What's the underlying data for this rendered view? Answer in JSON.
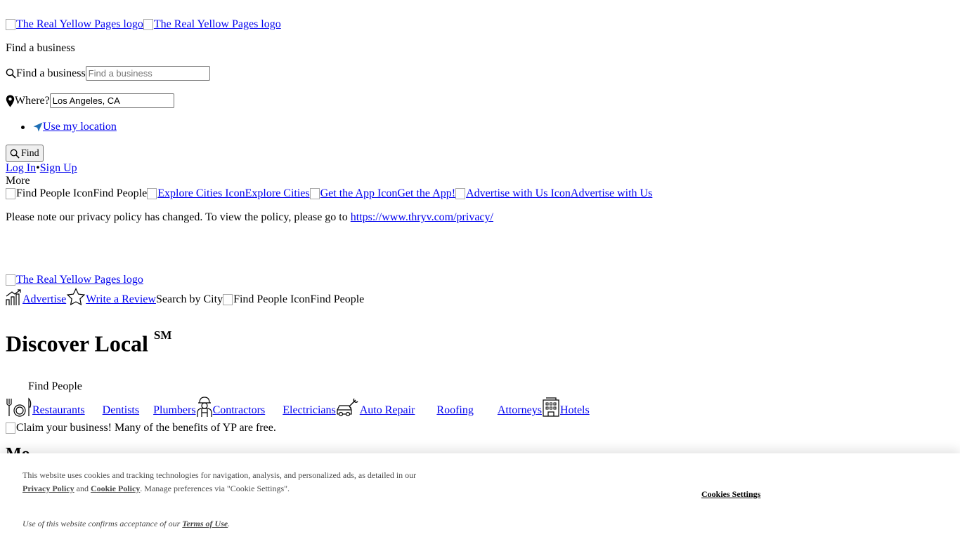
{
  "header": {
    "logo_alt_1": "The Real Yellow Pages logo",
    "logo_alt_2": "The Real Yellow Pages logo",
    "find_heading": "Find a business",
    "search_label": "Find a business",
    "search_placeholder": "Find a business",
    "where_label": "Where?",
    "where_value": "Los Angeles, CA",
    "use_location": "Use my location",
    "find_button": "Find",
    "login": "Log In",
    "separator": "•",
    "signup": "Sign Up",
    "more": "More"
  },
  "more_links": [
    {
      "alt": "Find People Icon",
      "label": "Find People",
      "link": false
    },
    {
      "alt": "Explore Cities Icon",
      "label": "Explore Cities",
      "link": true
    },
    {
      "alt": "Get the App Icon",
      "label": "Get the App!",
      "link": true
    },
    {
      "alt": "Advertise with Us Icon",
      "label": "Advertise with Us",
      "link": true
    }
  ],
  "privacy_notice": {
    "text": "Please note our privacy policy has changed. To view the policy, please go to",
    "link": "https://www.thryv.com/privacy/"
  },
  "nav2": {
    "logo_alt": "The Real Yellow Pages logo",
    "advertise": "Advertise",
    "write_review": "Write a Review",
    "search_by_city": "Search by City",
    "find_people_alt": "Find People Icon",
    "find_people": "Find People"
  },
  "hero": {
    "title": "Discover Local",
    "sup": "SM",
    "find_people": "Find People"
  },
  "categories": [
    {
      "label": "Restaurants",
      "icon": "fork-plate-knife-icon"
    },
    {
      "label": "Dentists",
      "icon": "tooth-icon"
    },
    {
      "label": "Plumbers",
      "icon": "wrench-icon"
    },
    {
      "label": "Contractors",
      "icon": "worker-icon"
    },
    {
      "label": "Electricians",
      "icon": "bolt-icon"
    },
    {
      "label": "Auto Repair",
      "icon": "car-wrench-icon"
    },
    {
      "label": "Roofing",
      "icon": "roof-icon"
    },
    {
      "label": "Attorneys",
      "icon": "gavel-icon"
    },
    {
      "label": "Hotels",
      "icon": "hotel-icon"
    }
  ],
  "claim": "Claim your business! Many of the benefits of YP are free.",
  "hidden_heading": "Mo",
  "cookie": {
    "text_1": "This website uses cookies and tracking technologies for navigation, analysis, and personalized ads, as detailed in our",
    "privacy_policy": "Privacy Policy",
    "and": "and",
    "cookie_policy": "Cookie Policy",
    "text_2": ". Manage preferences via \"Cookie Settings\".",
    "settings": "Cookies Settings",
    "terms_prefix": "Use of this website confirms acceptance of our",
    "terms": "Terms of Use",
    "terms_suffix": "."
  }
}
